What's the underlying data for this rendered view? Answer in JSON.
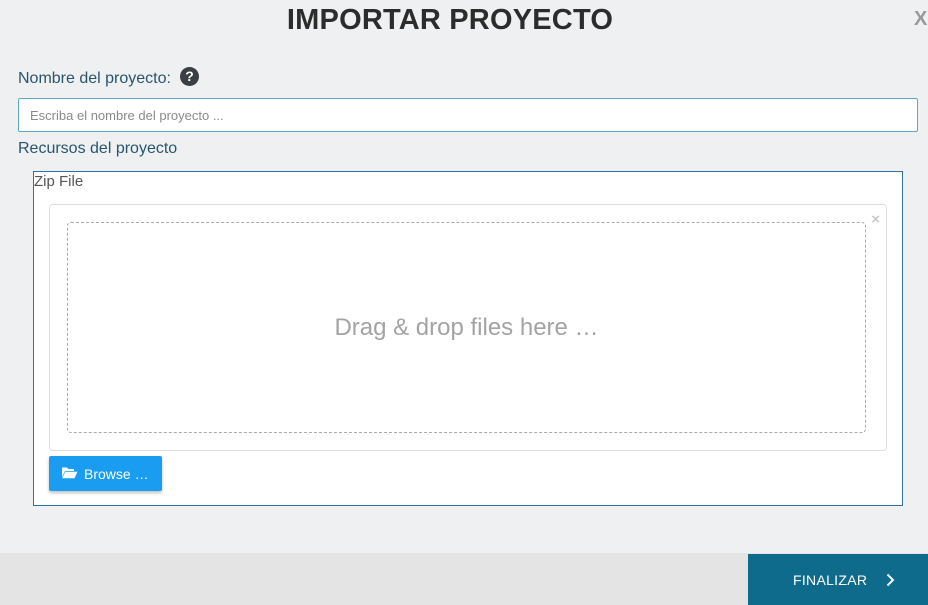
{
  "dialog": {
    "title": "IMPORTAR PROYECTO",
    "close_label": "X"
  },
  "project_name": {
    "label": "Nombre del proyecto:",
    "help_icon": "question-circle-icon",
    "placeholder": "Escriba el nombre del proyecto ...",
    "value": ""
  },
  "resources": {
    "label": "Recursos del proyecto",
    "zip_legend": "Zip File",
    "drop_text": "Drag & drop files here …",
    "clear_label": "×",
    "browse_label": "Browse …",
    "browse_icon": "folder-open-icon"
  },
  "footer": {
    "finalize_label": "FINALIZAR",
    "finalize_icon": "chevron-right-icon"
  },
  "colors": {
    "accent": "#1a9cf0",
    "finalize_bg": "#0e6b8c",
    "label_text": "#29556b",
    "background": "#eef0f1"
  }
}
